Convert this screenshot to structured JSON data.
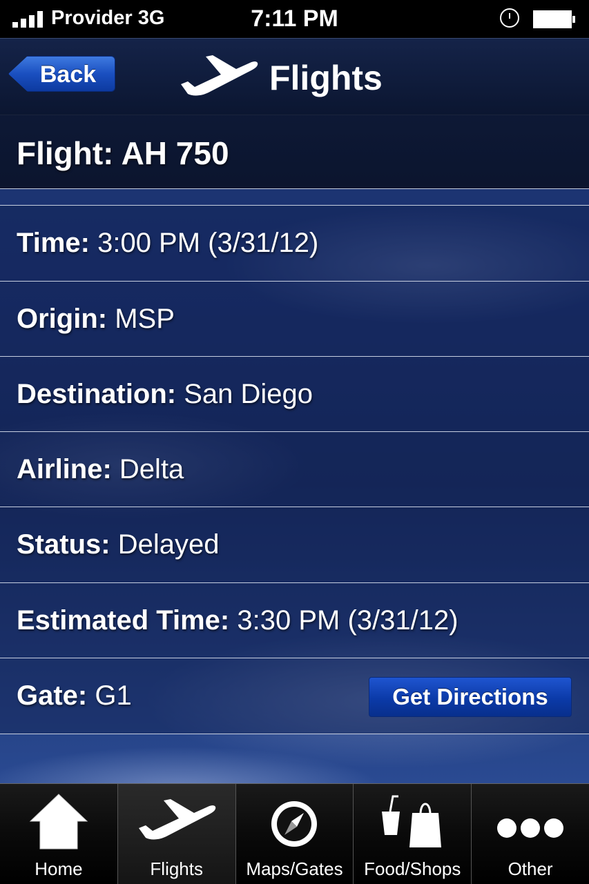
{
  "status_bar": {
    "carrier": "Provider 3G",
    "time": "7:11 PM"
  },
  "nav": {
    "back_label": "Back",
    "title": "Flights"
  },
  "flight": {
    "header": "Flight: AH 750",
    "rows": [
      {
        "label": "Time:",
        "value": " 3:00 PM (3/31/12)"
      },
      {
        "label": "Origin:",
        "value": "MSP"
      },
      {
        "label": "Destination:",
        "value": "San Diego"
      },
      {
        "label": "Airline:",
        "value": "Delta"
      },
      {
        "label": "Status:",
        "value": "Delayed"
      },
      {
        "label": "Estimated Time:",
        "value": "3:30 PM (3/31/12)"
      },
      {
        "label": "Gate:",
        "value": "G1"
      }
    ],
    "directions_label": "Get Directions"
  },
  "tabs": [
    {
      "label": "Home",
      "icon": "home-icon"
    },
    {
      "label": "Flights",
      "icon": "airplane-icon",
      "active": true
    },
    {
      "label": "Maps/Gates",
      "icon": "compass-icon"
    },
    {
      "label": "Food/Shops",
      "icon": "food-shopping-icon"
    },
    {
      "label": "Other",
      "icon": "more-icon"
    }
  ]
}
